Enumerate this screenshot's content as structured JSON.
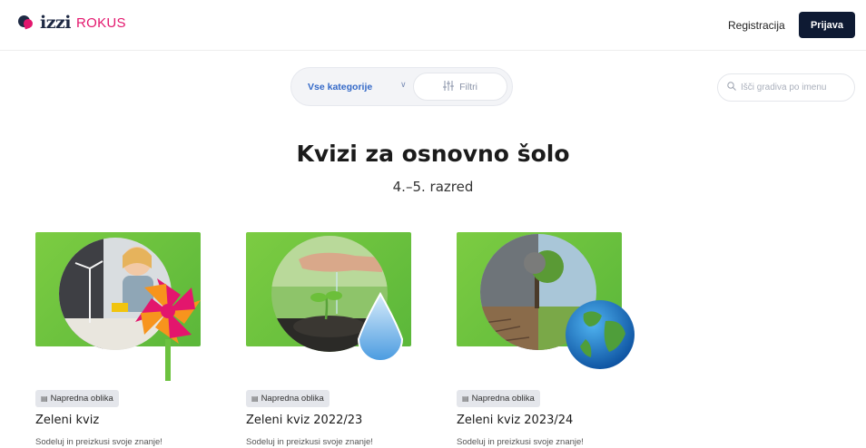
{
  "header": {
    "logo_main": "izzi",
    "logo_sub": "ROKUS",
    "register_label": "Registracija",
    "login_label": "Prijava"
  },
  "filters": {
    "category_label": "Vse kategorije",
    "filter_label": "Filtri",
    "search_placeholder": "Išči gradiva po imenu"
  },
  "page": {
    "title": "Kvizi za osnovno šolo",
    "subtitle": "4.–5. razred"
  },
  "cards": [
    {
      "badge": "Napredna oblika",
      "title": "Zeleni kviz",
      "description": "Sodeluj in preizkusi svoje znanje!"
    },
    {
      "badge": "Napredna oblika",
      "title": "Zeleni kviz 2022/23",
      "description": "Sodeluj in preizkusi svoje znanje!"
    },
    {
      "badge": "Napredna oblika",
      "title": "Zeleni kviz 2023/24",
      "description": "Sodeluj in preizkusi svoje znanje!"
    }
  ],
  "colors": {
    "brand_navy": "#0e1a33",
    "brand_pink": "#e3166d",
    "accent_blue": "#3469c8",
    "card_green": "#6cc23f"
  },
  "icons": {
    "chevron": "chevron-down-icon",
    "filter": "sliders-icon",
    "search": "search-icon",
    "badge": "document-icon"
  }
}
